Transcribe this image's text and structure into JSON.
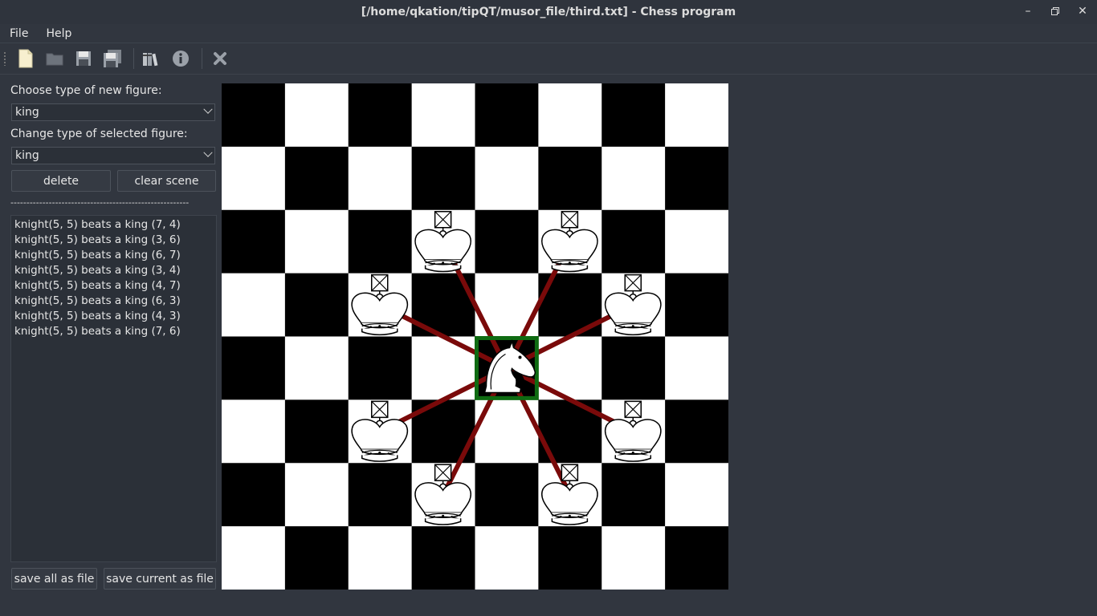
{
  "window": {
    "title": "[/home/qkation/tipQT/musor_file/third.txt] - Chess program",
    "controls": [
      "minimize",
      "restore",
      "close"
    ]
  },
  "menu": {
    "items": [
      "File",
      "Help"
    ]
  },
  "toolbar": {
    "buttons": [
      "new-file-icon",
      "open-folder-icon",
      "save-icon",
      "save-all-icon",
      "library-icon",
      "info-icon",
      "close-icon"
    ]
  },
  "left_panel": {
    "new_figure_label": "Choose type of new figure:",
    "new_figure_value": "king",
    "selected_figure_label": "Change type of selected figure:",
    "selected_figure_value": "king",
    "delete_label": "delete",
    "clear_label": "clear scene",
    "separator": "--------------------------------------------------------",
    "messages": [
      "knight(5, 5) beats a king (7, 4)",
      "knight(5, 5) beats a king (3, 6)",
      "knight(5, 5) beats a king (6, 7)",
      "knight(5, 5) beats a king (3, 4)",
      "knight(5, 5) beats a king (4, 7)",
      "knight(5, 5) beats a king (6, 3)",
      "knight(5, 5) beats a king (4, 3)",
      "knight(5, 5) beats a king (7, 6)"
    ],
    "save_all_label": "save all as file",
    "save_current_label": "save current as file"
  },
  "board": {
    "size": 8,
    "knight": {
      "col": 4,
      "row": 4
    },
    "kings": [
      {
        "col": 3,
        "row": 2
      },
      {
        "col": 5,
        "row": 2
      },
      {
        "col": 2,
        "row": 3
      },
      {
        "col": 6,
        "row": 3
      },
      {
        "col": 2,
        "row": 5
      },
      {
        "col": 6,
        "row": 5
      },
      {
        "col": 3,
        "row": 6
      },
      {
        "col": 5,
        "row": 6
      }
    ],
    "colors": {
      "dark": "#000000",
      "light": "#ffffff",
      "attack_line": "#7a0a0a",
      "selection": "#0f6b12"
    }
  }
}
